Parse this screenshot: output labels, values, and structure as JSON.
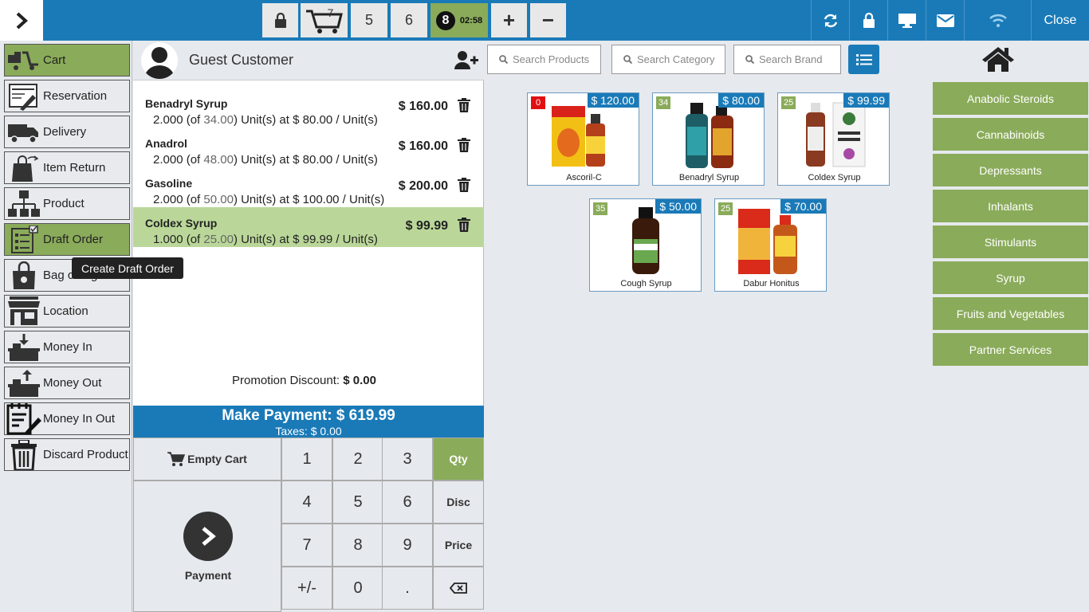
{
  "topbar": {
    "tickets": [
      {
        "label": "7"
      },
      {
        "label": "5"
      },
      {
        "label": "6"
      },
      {
        "label": "8",
        "timer": "02:58"
      }
    ],
    "plus": "+",
    "minus": "−",
    "close_label": "Close"
  },
  "sidebar": {
    "items": [
      {
        "label": "Cart",
        "icon": "cart-icon"
      },
      {
        "label": "Reservation",
        "icon": "reservation-icon"
      },
      {
        "label": "Delivery",
        "icon": "delivery-truck-icon"
      },
      {
        "label": "Item Return",
        "icon": "item-return-icon"
      },
      {
        "label": "Product",
        "icon": "product-hierarchy-icon"
      },
      {
        "label": "Draft Order",
        "icon": "draft-order-icon"
      },
      {
        "label": "Bag charges",
        "icon": "bag-icon"
      },
      {
        "label": "Location",
        "icon": "store-icon"
      },
      {
        "label": "Money In",
        "icon": "money-in-icon"
      },
      {
        "label": "Money Out",
        "icon": "money-out-icon"
      },
      {
        "label": "Money In Out",
        "icon": "money-in-out-icon"
      },
      {
        "label": "Discard Product",
        "icon": "trash-bin-icon"
      }
    ],
    "tooltip": "Create Draft Order"
  },
  "cart": {
    "customer": "Guest Customer",
    "lines": [
      {
        "name": "Benadryl Syrup",
        "qty": "2.000",
        "stock": "34.00",
        "unit_price": "$ 80.00",
        "total": "$ 160.00"
      },
      {
        "name": "Anadrol",
        "qty": "2.000",
        "stock": "48.00",
        "unit_price": "$ 80.00",
        "total": "$ 160.00"
      },
      {
        "name": "Gasoline",
        "qty": "2.000",
        "stock": "50.00",
        "unit_price": "$ 100.00",
        "total": "$ 200.00"
      },
      {
        "name": "Coldex Syrup",
        "qty": "1.000",
        "stock": "25.00",
        "unit_price": "$ 99.99",
        "total": "$ 99.99"
      }
    ],
    "promo_label": "Promotion Discount:",
    "promo_value": "$ 0.00",
    "make_payment": "Make Payment: $ 619.99",
    "taxes": "Taxes: $ 0.00"
  },
  "keypad": {
    "empty_cart": "Empty Cart",
    "payment": "Payment",
    "keys": [
      "1",
      "2",
      "3",
      "4",
      "5",
      "6",
      "7",
      "8",
      "9",
      "+/-",
      "0",
      "."
    ],
    "modes": [
      "Qty",
      "Disc",
      "Price"
    ],
    "active_mode": "Qty"
  },
  "search": {
    "products": "Search Products",
    "category": "Search Category",
    "brand": "Search Brand"
  },
  "products": [
    {
      "name": "Ascoril-C",
      "stock": "0",
      "price": "$ 120.00"
    },
    {
      "name": "Benadryl Syrup",
      "stock": "34",
      "price": "$ 80.00"
    },
    {
      "name": "Coldex Syrup",
      "stock": "25",
      "price": "$ 99.99"
    },
    {
      "name": "Cough Syrup",
      "stock": "35",
      "price": "$ 50.00"
    },
    {
      "name": "Dabur Honitus",
      "stock": "25",
      "price": "$ 70.00"
    }
  ],
  "categories": [
    "Anabolic Steroids",
    "Cannabinoids",
    "Depressants",
    "Inhalants",
    "Stimulants",
    "Syrup",
    "Fruits and Vegetables",
    "Partner Services"
  ],
  "colors": {
    "primary_blue": "#1a7ab8",
    "active_green": "#8aab5a",
    "selected_line": "#bad799",
    "stock_zero": "#e01010"
  }
}
